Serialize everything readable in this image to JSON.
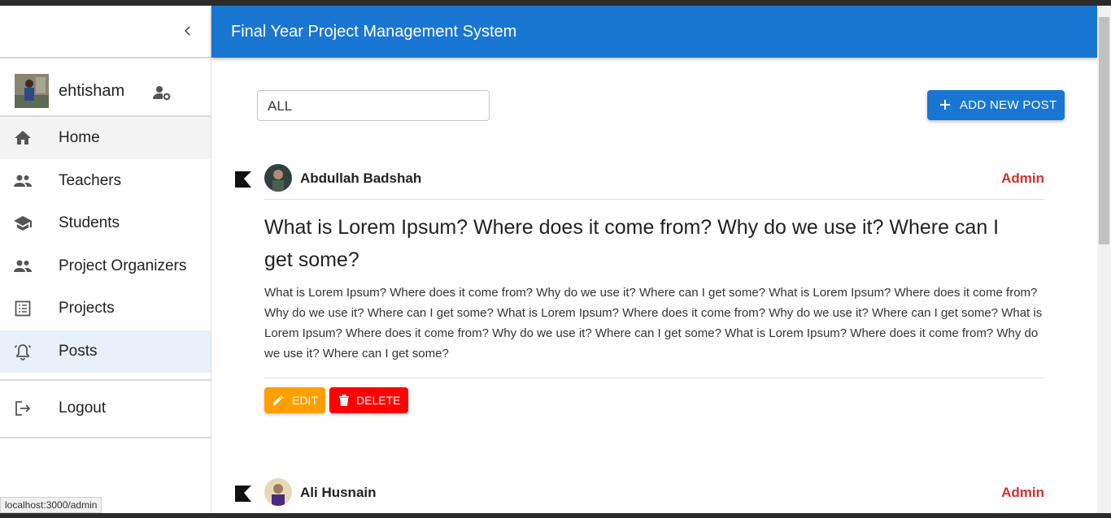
{
  "browser": {
    "status_url": "localhost:3000/admin"
  },
  "appbar": {
    "title": "Final Year Project Management System"
  },
  "sidebar": {
    "user": {
      "name": "ehtisham"
    },
    "items": [
      {
        "label": "Home",
        "icon": "home-icon"
      },
      {
        "label": "Teachers",
        "icon": "people-icon"
      },
      {
        "label": "Students",
        "icon": "school-icon"
      },
      {
        "label": "Project Organizers",
        "icon": "people-icon"
      },
      {
        "label": "Projects",
        "icon": "list-icon"
      },
      {
        "label": "Posts",
        "icon": "bell-icon",
        "active": true
      }
    ],
    "logout_label": "Logout"
  },
  "toolbar": {
    "filter_value": "ALL",
    "add_label": "ADD NEW POST"
  },
  "posts": [
    {
      "author": "Abdullah Badshah",
      "role": "Admin",
      "title": "What is Lorem Ipsum? Where does it come from? Why do we use it? Where can I get some?",
      "body": "What is Lorem Ipsum? Where does it come from? Why do we use it? Where can I get some? What is Lorem Ipsum? Where does it come from? Why do we use it? Where can I get some? What is Lorem Ipsum? Where does it come from? Why do we use it? Where can I get some? What is Lorem Ipsum? Where does it come from? Why do we use it? Where can I get some? What is Lorem Ipsum? Where does it come from? Why do we use it? Where can I get some?",
      "edit_label": "EDIT",
      "delete_label": "DELETE"
    },
    {
      "author": "Ali Husnain",
      "role": "Admin"
    }
  ],
  "colors": {
    "primary": "#1976d2",
    "admin_role": "#d32f2f",
    "edit_button": "#ffa000",
    "delete_button": "#ff0000"
  }
}
